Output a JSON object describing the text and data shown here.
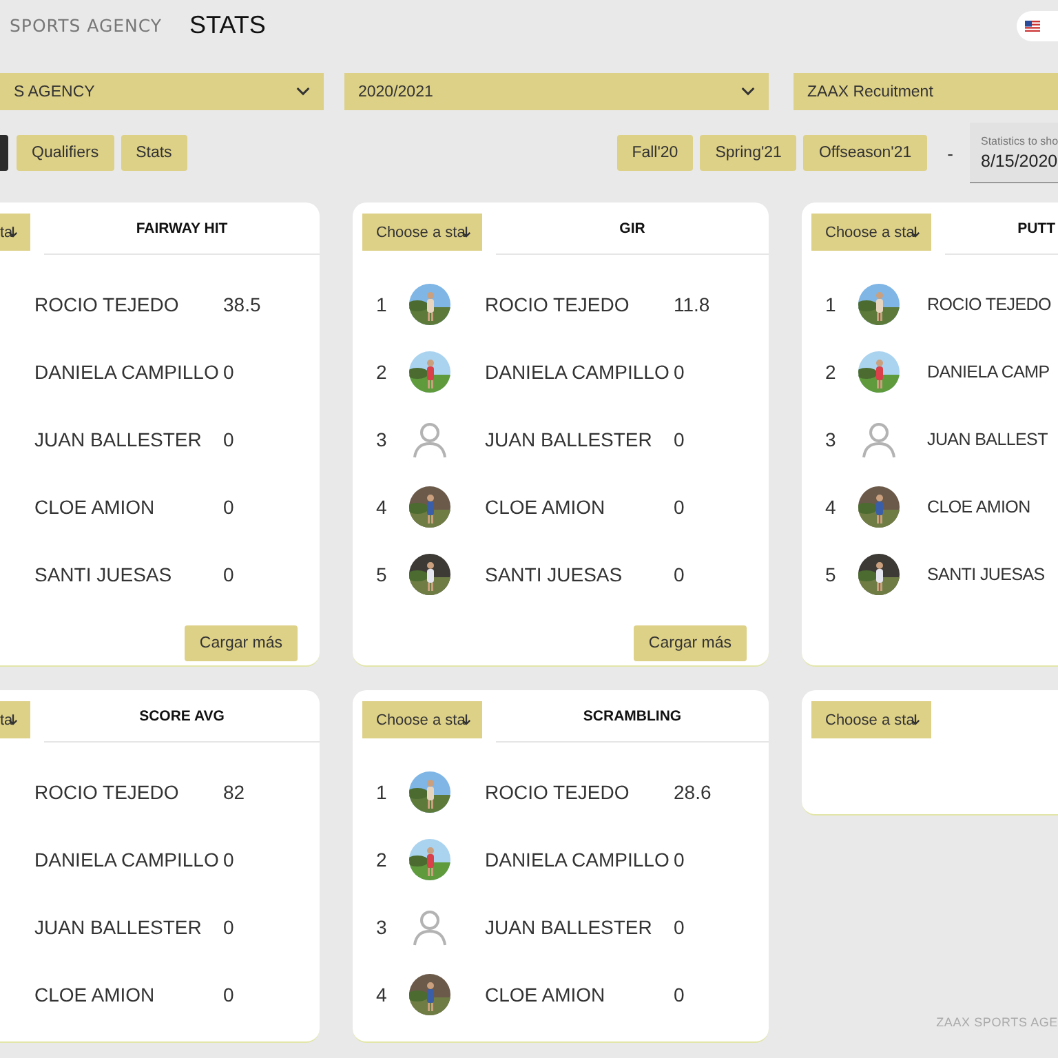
{
  "header": {
    "brand": "SPORTS AGENCY",
    "title": "STATS"
  },
  "selects": [
    {
      "value": "S AGENCY",
      "chevron": true
    },
    {
      "value": "2020/2021",
      "chevron": true
    },
    {
      "value": "ZAAX Recuitment",
      "chevron": false
    }
  ],
  "tabs": [
    {
      "selected": true
    },
    {
      "label": "Qualifiers",
      "selected": false
    },
    {
      "label": "Stats",
      "selected": false
    }
  ],
  "seasons": [
    {
      "label": "Fall'20"
    },
    {
      "label": "Spring'21"
    },
    {
      "label": "Offseason'21"
    }
  ],
  "separator": "-",
  "date_field": {
    "label": "Statistics to sho",
    "value": "8/15/2020"
  },
  "cards": [
    {
      "stat_select": "ta",
      "title": "FAIRWAY HIT",
      "rows": [
        {
          "kind": "plain",
          "name": "ROCIO TEJEDO",
          "value": "38.5"
        },
        {
          "kind": "plain",
          "name": "DANIELA CAMPILLO",
          "value": "0"
        },
        {
          "kind": "plain",
          "name": "JUAN BALLESTER",
          "value": "0"
        },
        {
          "kind": "plain",
          "name": "CLOE AMION",
          "value": "0"
        },
        {
          "kind": "plain",
          "name": "SANTI JUESAS",
          "value": "0"
        }
      ],
      "more_button": "Cargar más"
    },
    {
      "stat_select": "Choose a sta",
      "title": "GIR",
      "rows": [
        {
          "rank": "1",
          "name": "ROCIO TEJEDO",
          "value": "11.8"
        },
        {
          "rank": "2",
          "name": "DANIELA CAMPILLO",
          "value": "0"
        },
        {
          "rank": "3",
          "kind": "placeholder",
          "name": "JUAN BALLESTER",
          "value": "0"
        },
        {
          "rank": "4",
          "name": "CLOE AMION",
          "value": "0"
        },
        {
          "rank": "5",
          "name": "SANTI JUESAS",
          "value": "0"
        }
      ],
      "more_button": "Cargar más"
    },
    {
      "stat_select": "Choose a sta",
      "title": "PUTT",
      "rows": [
        {
          "rank": "1",
          "name": "ROCIO TEJEDO"
        },
        {
          "rank": "2",
          "name": "DANIELA CAMP"
        },
        {
          "rank": "3",
          "kind": "placeholder",
          "name": "JUAN BALLEST"
        },
        {
          "rank": "4",
          "name": "CLOE AMION"
        },
        {
          "rank": "5",
          "name": "SANTI JUESAS"
        }
      ]
    },
    {
      "stat_select": "ta",
      "title": "SCORE AVG",
      "rows": [
        {
          "kind": "plain",
          "name": "ROCIO TEJEDO",
          "value": "82"
        },
        {
          "kind": "plain",
          "name": "DANIELA CAMPILLO",
          "value": "0"
        },
        {
          "kind": "plain",
          "name": "JUAN BALLESTER",
          "value": "0"
        },
        {
          "kind": "plain",
          "name": "CLOE AMION",
          "value": "0"
        }
      ]
    },
    {
      "stat_select": "Choose a sta",
      "title": "SCRAMBLING",
      "rows": [
        {
          "rank": "1",
          "name": "ROCIO TEJEDO",
          "value": "28.6"
        },
        {
          "rank": "2",
          "name": "DANIELA CAMPILLO",
          "value": "0"
        },
        {
          "rank": "3",
          "kind": "placeholder",
          "name": "JUAN BALLESTER",
          "value": "0"
        },
        {
          "rank": "4",
          "name": "CLOE AMION",
          "value": "0"
        }
      ]
    },
    {
      "stat_select": "Choose a sta"
    }
  ],
  "footer": "ZAAX SPORTS AGE"
}
